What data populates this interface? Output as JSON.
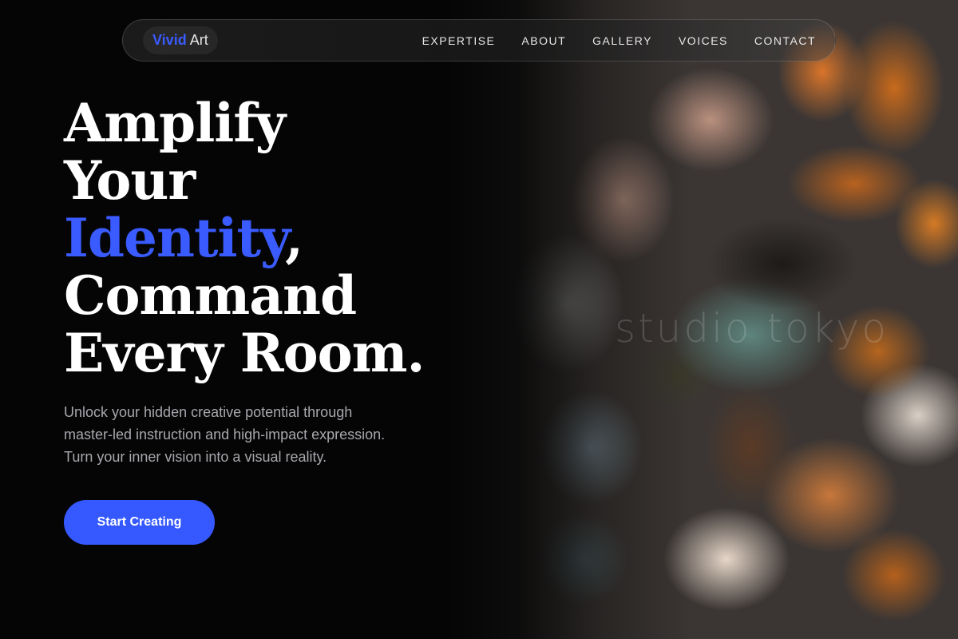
{
  "brand": {
    "primary": "Vivid",
    "secondary": "Art",
    "accent_color": "#3a5bff"
  },
  "nav": {
    "items": [
      {
        "label": "EXPERTISE"
      },
      {
        "label": "ABOUT"
      },
      {
        "label": "GALLERY"
      },
      {
        "label": "VOICES"
      },
      {
        "label": "CONTACT"
      }
    ]
  },
  "hero": {
    "line1": "Amplify",
    "line2": "Your",
    "line3_accent": "Identity",
    "line3_rest": ",",
    "line4": "Command",
    "line5": "Every Room.",
    "subtitle_lines": [
      "Unlock your hidden creative potential through",
      "master-led instruction and high-impact expression.",
      "Turn your inner vision into a visual reality."
    ],
    "cta_label": "Start Creating"
  },
  "image": {
    "watermark": "studio tokyo"
  }
}
